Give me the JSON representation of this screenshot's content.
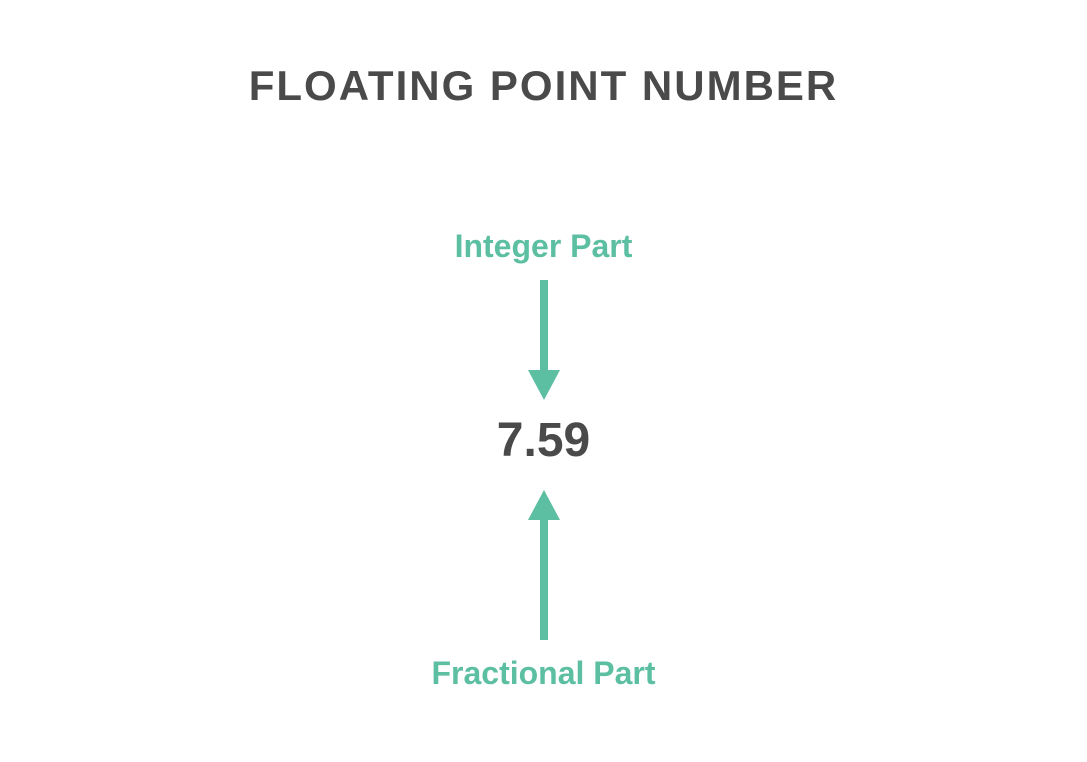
{
  "title": "FLOATING POINT NUMBER",
  "integer_label": "Integer Part",
  "fractional_label": "Fractional Part",
  "number_value": "7.59",
  "colors": {
    "accent": "#5cbfa2",
    "text": "#4a4a4a"
  }
}
